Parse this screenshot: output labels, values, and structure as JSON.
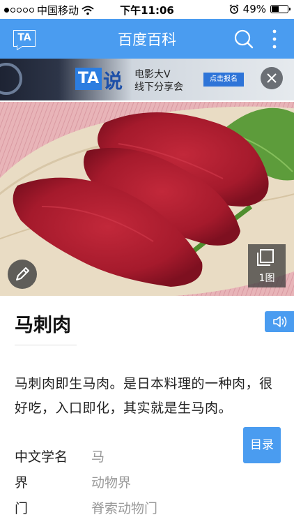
{
  "status_bar": {
    "carrier": "中国移动",
    "time": "下午11:06",
    "battery_text": "49%",
    "battery_level": 0.49,
    "signal_bars_on": 1,
    "signal_bars_total": 5
  },
  "header": {
    "logo_text": "TA",
    "title": "百度百科",
    "search_icon": "search-icon",
    "more_icon": "more-vertical-icon",
    "background_color": "#4a9cf0"
  },
  "banner": {
    "badge": "TA",
    "brand": "说",
    "line1": "电影大V",
    "line2": "线下分享会",
    "cta": "点击报名"
  },
  "hero": {
    "gallery_count": "1图",
    "edit_icon": "pencil-icon",
    "gallery_icon": "gallery-icon"
  },
  "entry": {
    "title": "马刺肉",
    "summary": "马刺肉即生马肉。是日本料理的一种肉，很好吃，入口即化，其实就是生马肉。",
    "toc_label": "目录",
    "info": [
      {
        "key": "中文学名",
        "value": "马"
      },
      {
        "key": "界",
        "value": "动物界"
      },
      {
        "key": "门",
        "value": "脊索动物门"
      }
    ]
  }
}
